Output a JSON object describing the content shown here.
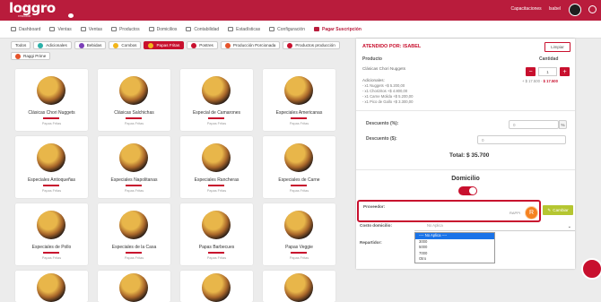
{
  "app": {
    "logo": "loggro",
    "logo_sub": "restobar"
  },
  "topbar": {
    "link": "Capacitaciones",
    "user": "Isabel"
  },
  "nav": [
    {
      "label": "Dashboard",
      "active": false
    },
    {
      "label": "Ventas",
      "active": false
    },
    {
      "label": "Ventas",
      "active": false
    },
    {
      "label": "Productos",
      "active": false
    },
    {
      "label": "Domicilios",
      "active": false
    },
    {
      "label": "Contabilidad",
      "active": false
    },
    {
      "label": "Estadísticas",
      "active": false
    },
    {
      "label": "Configuración",
      "active": false
    },
    {
      "label": "Pagar Suscripción",
      "active": true
    }
  ],
  "categories": [
    {
      "label": "Todos",
      "color": "",
      "active": false
    },
    {
      "label": "Adicionales",
      "color": "#2ab0a8",
      "active": false
    },
    {
      "label": "Bebidas",
      "color": "#7b3fb8",
      "active": false
    },
    {
      "label": "Combos",
      "color": "#f2b51a",
      "active": false
    },
    {
      "label": "Papas Fritas",
      "color": "#f2b51a",
      "active": true
    },
    {
      "label": "Postres",
      "color": "#c8102e",
      "active": false
    },
    {
      "label": "Producción Porcionada",
      "color": "#e5532a",
      "active": false
    },
    {
      "label": "Productos producción",
      "color": "#c8102e",
      "active": false
    },
    {
      "label": "Raggi Prime",
      "color": "#e5532a",
      "active": false
    }
  ],
  "products": [
    {
      "name": "Clásicas Chori Nuggets",
      "category": "Papas Fritas"
    },
    {
      "name": "Clásicas Salchichas",
      "category": "Papas Fritas"
    },
    {
      "name": "Especial de Camarones",
      "category": "Papas Fritas"
    },
    {
      "name": "Especiales Americanas",
      "category": "Papas Fritas"
    },
    {
      "name": "Especiales Antioqueñas",
      "category": "Papas Fritas"
    },
    {
      "name": "Especiales Napolitanas",
      "category": "Papas Fritas"
    },
    {
      "name": "Especiales Rancheras",
      "category": "Papas Fritas"
    },
    {
      "name": "Especiales de Carne",
      "category": "Papas Fritas"
    },
    {
      "name": "Especiales de Pollo",
      "category": "Papas Fritas"
    },
    {
      "name": "Especiales de la Casa",
      "category": "Papas Fritas"
    },
    {
      "name": "Papas Barbecues",
      "category": "Papas Fritas"
    },
    {
      "name": "Papas Veggie",
      "category": "Papas Fritas"
    },
    {
      "name": "",
      "category": ""
    },
    {
      "name": "",
      "category": ""
    },
    {
      "name": "",
      "category": ""
    },
    {
      "name": "",
      "category": ""
    }
  ],
  "order": {
    "attended_by": "ATENDIDO POR: ISABEL",
    "clear_label": "Limpiar",
    "col_product": "Producto",
    "col_quantity": "Cantidad",
    "item_name": "Clásicas Chori Nuggets",
    "quantity": "1",
    "unit_price": "+ $ 17.500 -",
    "line_total": "$ 17.500",
    "adicionales_title": "Adicionales:",
    "adicionales": [
      "- x1 Nuggets +$ 5.200,00",
      "- x1 Chorizitos +$ 4.800,00",
      "- x1 Carne Molida +$ 5.200,00",
      "- x1 Pico de Gallo +$ 3.300,00"
    ],
    "discount_pct_label": "Descuento (%):",
    "discount_pct_value": "0",
    "discount_pct_suffix": "%",
    "discount_amt_label": "Descuento ($):",
    "discount_amt_value": "0",
    "total": "Total: $ 35.700",
    "domicilio_title": "Domicilio",
    "domicilio_on": true,
    "provider_label": "Proveedor:",
    "provider_name": "RAPPI",
    "provider_initial": "R",
    "change_button": "Cambiar",
    "cost_label": "Costo domicilio:",
    "cost_placeholder": "No Aplica",
    "cost_options": [
      "---- No Aplica ----",
      "3000",
      "5000",
      "7000",
      "Otro"
    ],
    "cost_selected_index": 0,
    "delivery_label": "Repartidor:"
  }
}
